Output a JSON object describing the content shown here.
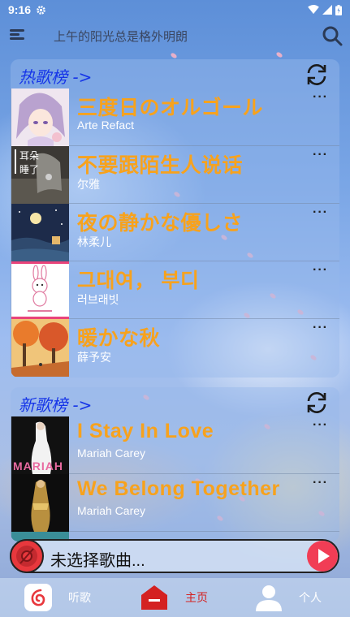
{
  "status_bar": {
    "time": "9:16",
    "icons": [
      "settings-gear-icon",
      "wifi-icon",
      "signal-icon",
      "battery-icon"
    ]
  },
  "header": {
    "search_text": "上午的阳光总是格外明朗",
    "menu_icon": "menu-icon",
    "search_icon": "search-icon"
  },
  "hot_chart": {
    "title": "热歌榜 ->",
    "songs": [
      {
        "title": "三度日のオルゴール",
        "artist": "Arte Refact"
      },
      {
        "title": "不要跟陌生人说话",
        "artist": "尔雅"
      },
      {
        "title": "夜の静かな優しさ",
        "artist": "林柔儿"
      },
      {
        "title": "그대여， 부디",
        "artist": "러브래빗"
      },
      {
        "title": "暖かな秋",
        "artist": "薛予安"
      }
    ]
  },
  "new_chart": {
    "title": "新歌榜 ->",
    "songs": [
      {
        "title": "I Stay In Love",
        "artist": "Mariah Carey"
      },
      {
        "title": "We Belong Together",
        "artist": "Mariah Carey"
      }
    ]
  },
  "cover_text": {
    "cover2_line1": "耳朵",
    "cover2_line2": "睡了",
    "cover6": "MARIAH"
  },
  "more_label": "···",
  "player": {
    "now_playing": "未选择歌曲..."
  },
  "bottom_nav": {
    "tabs": [
      {
        "label": "听歌",
        "icon": "music-app-icon"
      },
      {
        "label": "主页",
        "icon": "home-icon"
      },
      {
        "label": "个人",
        "icon": "person-icon"
      }
    ]
  },
  "colors": {
    "accent_orange": "#f7a21d",
    "chart_title_blue": "#1534e8",
    "player_red": "#e8383d",
    "nav_active": "#d42121"
  }
}
